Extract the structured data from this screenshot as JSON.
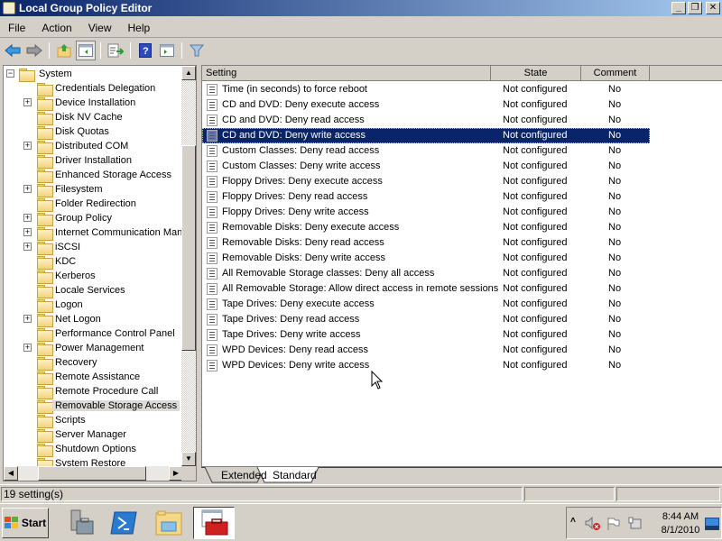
{
  "window": {
    "title": "Local Group Policy Editor",
    "controls": [
      "minimize",
      "restore",
      "close"
    ]
  },
  "menu": [
    "File",
    "Action",
    "View",
    "Help"
  ],
  "toolbar": {
    "buttons": [
      "back-icon",
      "forward-icon",
      "up-folder-icon",
      "show-hide-tree-icon",
      "export-list-icon",
      "help-icon",
      "show-hide-action-pane-icon",
      "filter-icon"
    ]
  },
  "tree": {
    "root": "System",
    "items": [
      {
        "label": "Credentials Delegation",
        "expandable": false
      },
      {
        "label": "Device Installation",
        "expandable": true
      },
      {
        "label": "Disk NV Cache",
        "expandable": false
      },
      {
        "label": "Disk Quotas",
        "expandable": false
      },
      {
        "label": "Distributed COM",
        "expandable": true
      },
      {
        "label": "Driver Installation",
        "expandable": false
      },
      {
        "label": "Enhanced Storage Access",
        "expandable": false
      },
      {
        "label": "Filesystem",
        "expandable": true
      },
      {
        "label": "Folder Redirection",
        "expandable": false
      },
      {
        "label": "Group Policy",
        "expandable": true
      },
      {
        "label": "Internet Communication Management",
        "expandable": true
      },
      {
        "label": "iSCSI",
        "expandable": true
      },
      {
        "label": "KDC",
        "expandable": false
      },
      {
        "label": "Kerberos",
        "expandable": false
      },
      {
        "label": "Locale Services",
        "expandable": false
      },
      {
        "label": "Logon",
        "expandable": false
      },
      {
        "label": "Net Logon",
        "expandable": true
      },
      {
        "label": "Performance Control Panel",
        "expandable": false
      },
      {
        "label": "Power Management",
        "expandable": true
      },
      {
        "label": "Recovery",
        "expandable": false
      },
      {
        "label": "Remote Assistance",
        "expandable": false
      },
      {
        "label": "Remote Procedure Call",
        "expandable": false
      },
      {
        "label": "Removable Storage Access",
        "expandable": false,
        "selected": true
      },
      {
        "label": "Scripts",
        "expandable": false
      },
      {
        "label": "Server Manager",
        "expandable": false
      },
      {
        "label": "Shutdown Options",
        "expandable": false
      },
      {
        "label": "System Restore",
        "expandable": false
      }
    ]
  },
  "list": {
    "columns": [
      "Setting",
      "State",
      "Comment"
    ],
    "rows": [
      {
        "setting": "Time (in seconds) to force reboot",
        "state": "Not configured",
        "comment": "No"
      },
      {
        "setting": "CD and DVD: Deny execute access",
        "state": "Not configured",
        "comment": "No"
      },
      {
        "setting": "CD and DVD: Deny read access",
        "state": "Not configured",
        "comment": "No"
      },
      {
        "setting": "CD and DVD: Deny write access",
        "state": "Not configured",
        "comment": "No",
        "selected": true
      },
      {
        "setting": "Custom Classes: Deny read access",
        "state": "Not configured",
        "comment": "No"
      },
      {
        "setting": "Custom Classes: Deny write access",
        "state": "Not configured",
        "comment": "No"
      },
      {
        "setting": "Floppy Drives: Deny execute access",
        "state": "Not configured",
        "comment": "No"
      },
      {
        "setting": "Floppy Drives: Deny read access",
        "state": "Not configured",
        "comment": "No"
      },
      {
        "setting": "Floppy Drives: Deny write access",
        "state": "Not configured",
        "comment": "No"
      },
      {
        "setting": "Removable Disks: Deny execute access",
        "state": "Not configured",
        "comment": "No"
      },
      {
        "setting": "Removable Disks: Deny read access",
        "state": "Not configured",
        "comment": "No"
      },
      {
        "setting": "Removable Disks: Deny write access",
        "state": "Not configured",
        "comment": "No"
      },
      {
        "setting": "All Removable Storage classes: Deny all access",
        "state": "Not configured",
        "comment": "No"
      },
      {
        "setting": "All Removable Storage: Allow direct access in remote sessions",
        "state": "Not configured",
        "comment": "No"
      },
      {
        "setting": "Tape Drives: Deny execute access",
        "state": "Not configured",
        "comment": "No"
      },
      {
        "setting": "Tape Drives: Deny read access",
        "state": "Not configured",
        "comment": "No"
      },
      {
        "setting": "Tape Drives: Deny write access",
        "state": "Not configured",
        "comment": "No"
      },
      {
        "setting": "WPD Devices: Deny read access",
        "state": "Not configured",
        "comment": "No"
      },
      {
        "setting": "WPD Devices: Deny write access",
        "state": "Not configured",
        "comment": "No"
      }
    ]
  },
  "tabs": [
    {
      "label": "Extended",
      "active": false
    },
    {
      "label": "Standard",
      "active": true
    }
  ],
  "status": {
    "text": "19 setting(s)"
  },
  "taskbar": {
    "start_label": "Start",
    "apps": [
      "server-manager-icon",
      "powershell-icon",
      "windows-explorer-icon",
      "group-policy-editor-icon"
    ],
    "tray_icons": [
      "show-hidden-icons-chevron",
      "volume-muted-icon",
      "action-center-flag-icon",
      "network-icon"
    ],
    "time": "8:44 AM",
    "date": "8/1/2010"
  },
  "colors": {
    "titlebar_start": "#0a246a",
    "titlebar_end": "#a6caf0",
    "selection": "#0a246a",
    "chrome": "#d4d0c8"
  }
}
